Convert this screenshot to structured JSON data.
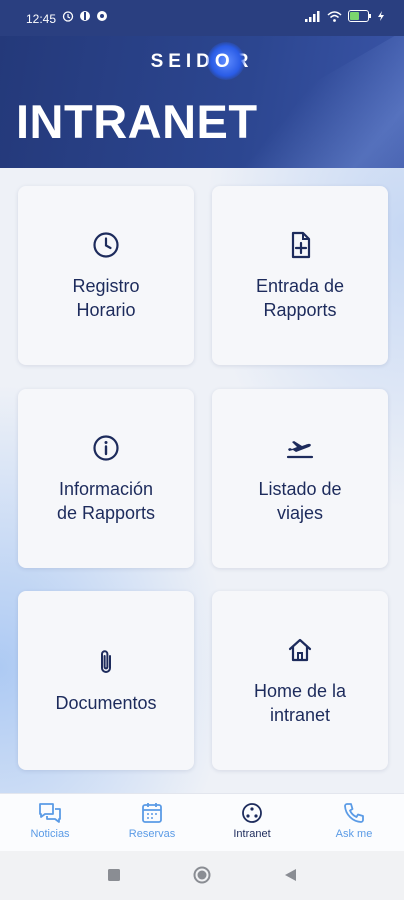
{
  "status_bar": {
    "time": "12:45",
    "left_icons": [
      "alarm-icon",
      "app-icon",
      "app-icon"
    ],
    "right_icons": [
      "signal-icon",
      "wifi-icon",
      "battery-icon",
      "charging-icon"
    ]
  },
  "header": {
    "logo_text_left": "SEID",
    "logo_text_o": "O",
    "logo_text_right": "R",
    "title": "INTRANET"
  },
  "cards": [
    {
      "label_line1": "Registro",
      "label_line2": "Horario",
      "icon": "clock-icon"
    },
    {
      "label_line1": "Entrada de",
      "label_line2": "Rapports",
      "icon": "file-add-icon"
    },
    {
      "label_line1": "Información",
      "label_line2": "de Rapports",
      "icon": "info-icon"
    },
    {
      "label_line1": "Listado de",
      "label_line2": "viajes",
      "icon": "plane-takeoff-icon"
    },
    {
      "label_line1": "Documentos",
      "label_line2": "",
      "icon": "paperclip-icon"
    },
    {
      "label_line1": "Home de la",
      "label_line2": "intranet",
      "icon": "home-icon"
    }
  ],
  "bottom_nav": [
    {
      "label": "Noticias",
      "icon": "chat-icon",
      "active": false
    },
    {
      "label": "Reservas",
      "icon": "calendar-icon",
      "active": false
    },
    {
      "label": "Intranet",
      "icon": "intranet-icon",
      "active": true
    },
    {
      "label": "Ask me",
      "icon": "phone-icon",
      "active": false
    }
  ],
  "colors": {
    "header": "#2a3f80",
    "card_text": "#1d2b5c",
    "nav_inactive": "#5b9be6",
    "nav_active": "#1d2b5c"
  }
}
